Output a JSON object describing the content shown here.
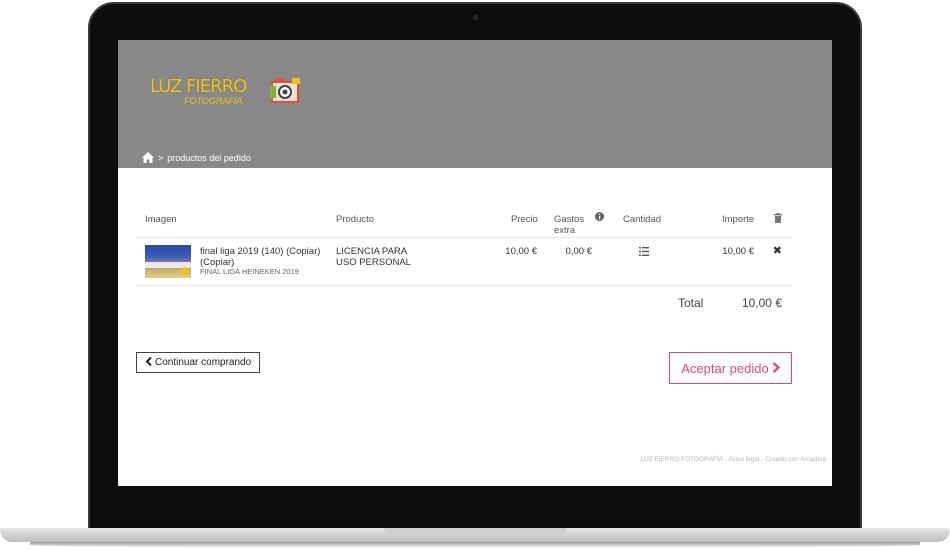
{
  "brand": {
    "name": "LUZ FIERRO",
    "sub": "FOTOGRAFÍA",
    "accent": "#f0c21c"
  },
  "breadcrumb": {
    "separator": ">",
    "current": "productos del pedido"
  },
  "cart": {
    "headers": {
      "image": "Imagen",
      "product": "Producto",
      "price": "Precio",
      "extra": "Gastos extra",
      "quantity": "Cantidad",
      "amount": "Importe"
    },
    "items": [
      {
        "title": "final liga 2019 (140) (Copiar) (Copiar)",
        "subtitle": "FINAL LIGA HEINEKEN 2019",
        "product": "LICENCIA PARA USO PERSONAL",
        "price": "10,00 €",
        "extra": "0,00 €",
        "amount": "10,00 €"
      }
    ],
    "total_label": "Total",
    "total_value": "10,00 €"
  },
  "actions": {
    "continue_label": "Continuar comprando",
    "accept_label": "Aceptar pedido",
    "accent": "#e2457f"
  },
  "footer": {
    "text": "LUZ FIERRO FOTOGRAFÍA - Aviso legal - Creado con Arcadina"
  }
}
